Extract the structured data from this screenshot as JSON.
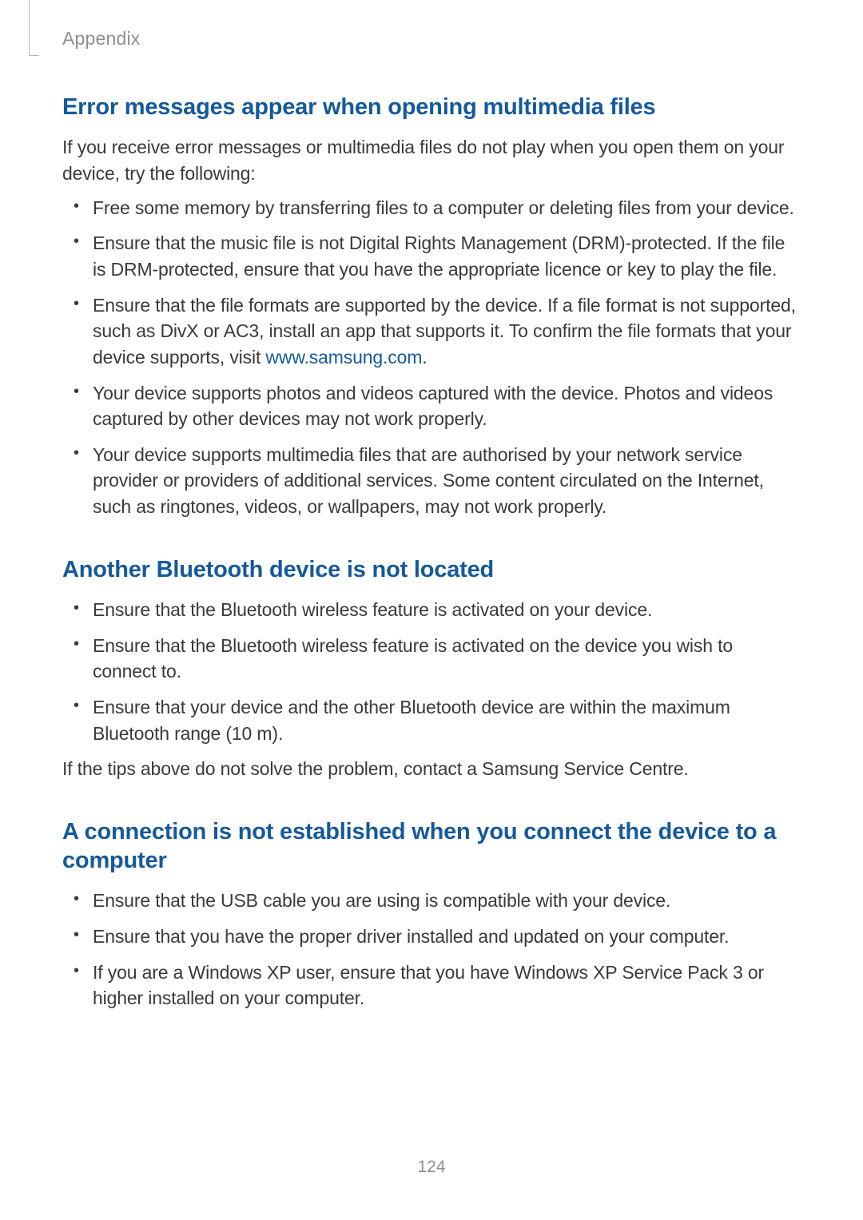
{
  "header": {
    "running_head": "Appendix"
  },
  "sections": [
    {
      "title": "Error messages appear when opening multimedia files",
      "intro": "If you receive error messages or multimedia files do not play when you open them on your device, try the following:",
      "bullets": [
        {
          "text": "Free some memory by transferring files to a computer or deleting files from your device."
        },
        {
          "text": "Ensure that the music file is not Digital Rights Management (DRM)-protected. If the file is DRM-protected, ensure that you have the appropriate licence or key to play the file."
        },
        {
          "pre": "Ensure that the file formats are supported by the device. If a file format is not supported, such as DivX or AC3, install an app that supports it. To confirm the file formats that your device supports, visit ",
          "link_text": "www.samsung.com",
          "post": "."
        },
        {
          "text": "Your device supports photos and videos captured with the device. Photos and videos captured by other devices may not work properly."
        },
        {
          "text": "Your device supports multimedia files that are authorised by your network service provider or providers of additional services. Some content circulated on the Internet, such as ringtones, videos, or wallpapers, may not work properly."
        }
      ]
    },
    {
      "title": "Another Bluetooth device is not located",
      "bullets": [
        {
          "text": "Ensure that the Bluetooth wireless feature is activated on your device."
        },
        {
          "text": "Ensure that the Bluetooth wireless feature is activated on the device you wish to connect to."
        },
        {
          "text": "Ensure that your device and the other Bluetooth device are within the maximum Bluetooth range (10 m)."
        }
      ],
      "outro": "If the tips above do not solve the problem, contact a Samsung Service Centre."
    },
    {
      "title": "A connection is not established when you connect the device to a computer",
      "bullets": [
        {
          "text": "Ensure that the USB cable you are using is compatible with your device."
        },
        {
          "text": "Ensure that you have the proper driver installed and updated on your computer."
        },
        {
          "text": "If you are a Windows XP user, ensure that you have Windows XP Service Pack 3 or higher installed on your computer."
        }
      ]
    }
  ],
  "page_number": "124"
}
